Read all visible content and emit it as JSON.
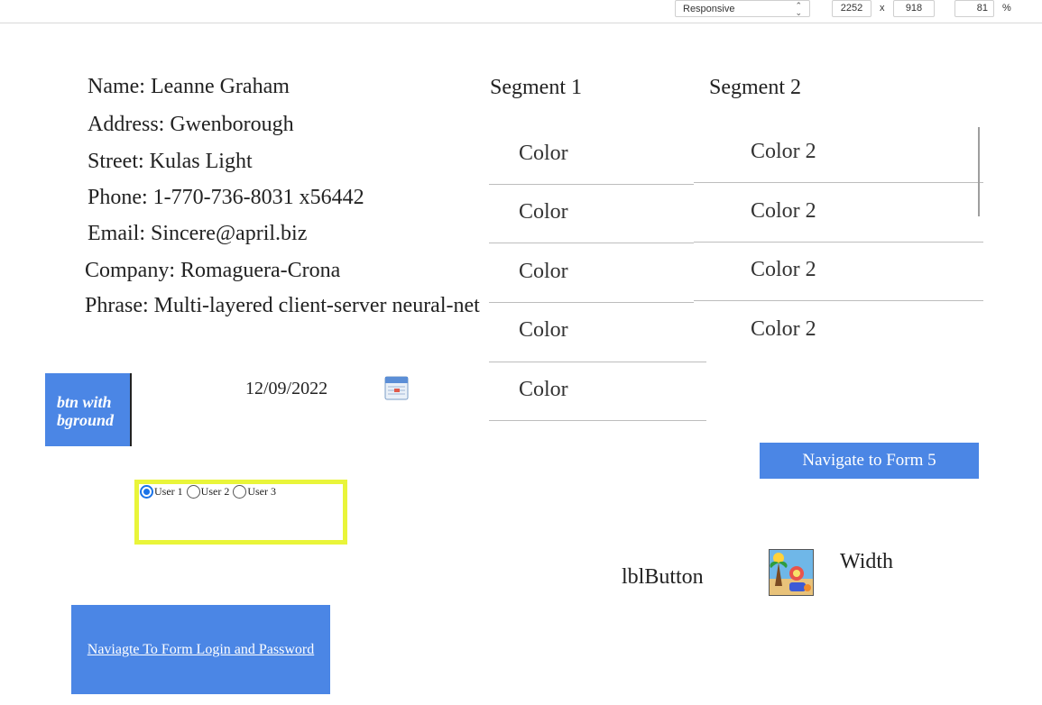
{
  "devtools": {
    "device": "Responsive",
    "width": "2252",
    "times": "x",
    "height": "918",
    "zoom": "81",
    "percent": "%"
  },
  "user": {
    "name": "Name: Leanne Graham",
    "address": "Address: Gwenborough",
    "street": "Street: Kulas Light",
    "phone": "Phone: 1-770-736-8031 x56442",
    "email": "Email: Sincere@april.biz",
    "company": "Company: Romaguera-Crona",
    "phrase": "Phrase: Multi-layered client-server neural-net"
  },
  "segments": {
    "segment1": {
      "title": "Segment 1",
      "items": [
        "Color",
        "Color",
        "Color",
        "Color",
        "Color"
      ]
    },
    "segment2": {
      "title": "Segment 2",
      "items": [
        "Color 2",
        "Color 2",
        "Color 2",
        "Color 2"
      ]
    }
  },
  "buttons": {
    "btn_with_bground": "btn with bground",
    "navigate_form5": "Navigate to Form 5",
    "navigate_login": "Naviagte To Form Login and Password",
    "lbl_button": "lblButton"
  },
  "date": {
    "value": "12/09/2022"
  },
  "radios": {
    "options": [
      "User 1",
      "User 2",
      "User 3"
    ],
    "selected": "User 1"
  },
  "width_label": "Width",
  "icons": {
    "calendar": "calendar-icon",
    "picture": "beach-picture"
  },
  "colors": {
    "button_blue": "#4b86e5",
    "radio_frame": "#e9f53a"
  }
}
